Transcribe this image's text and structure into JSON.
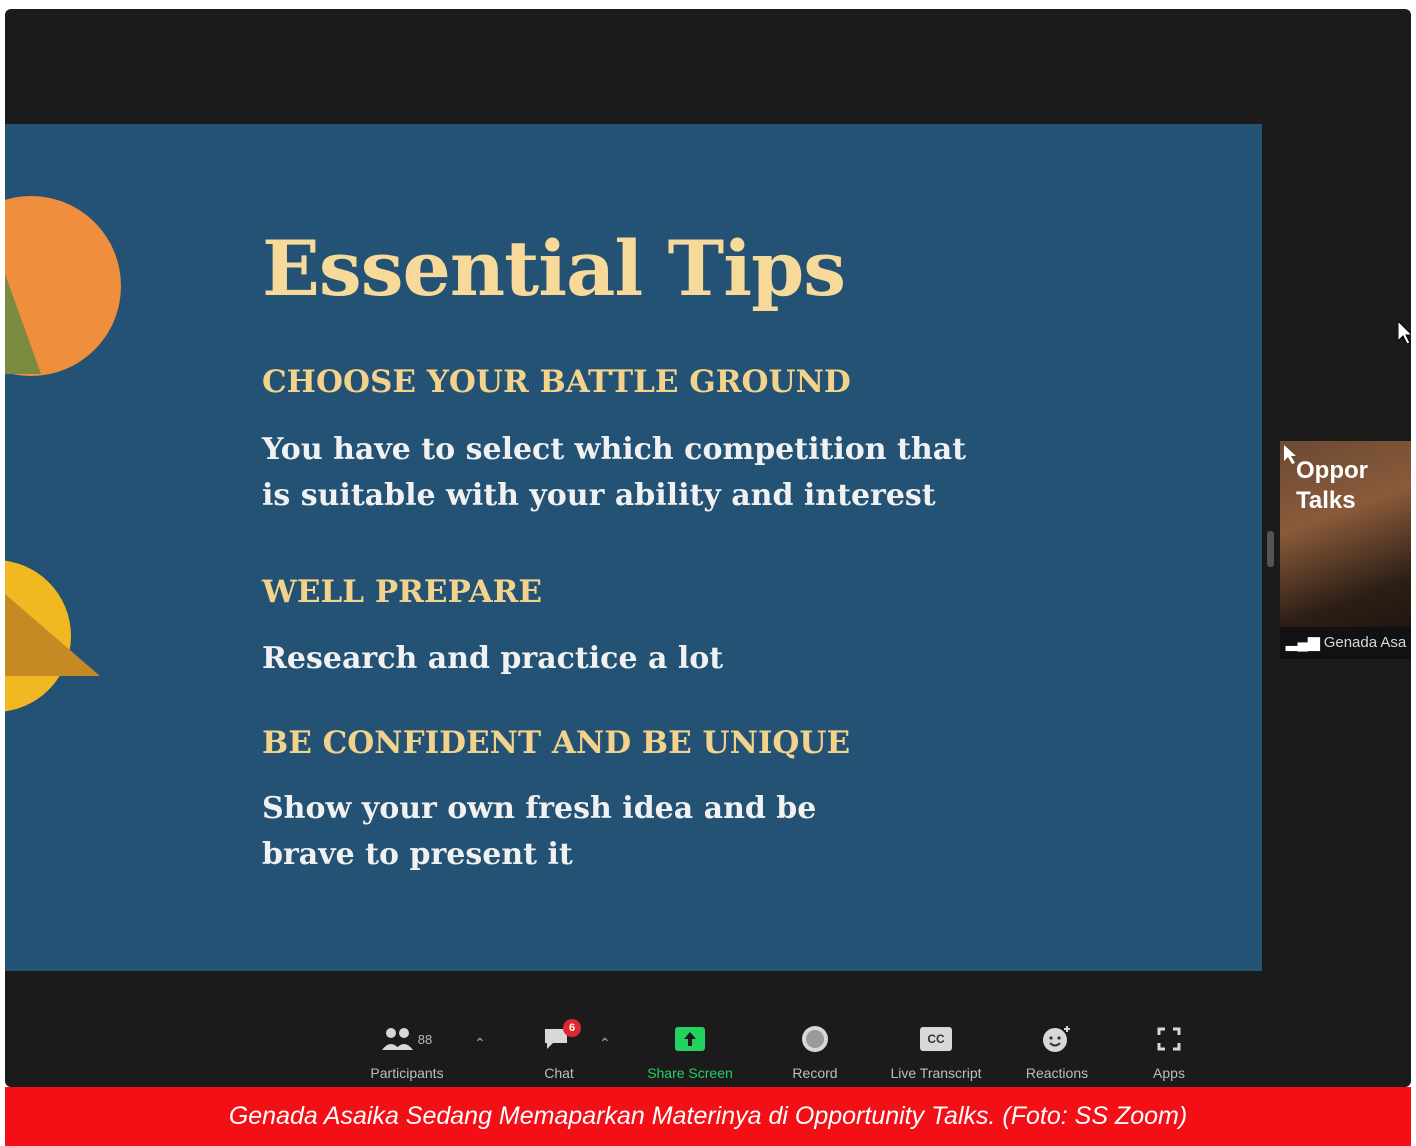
{
  "slide": {
    "title": "Essential Tips",
    "sections": [
      {
        "heading": "CHOOSE YOUR BATTLE GROUND",
        "lines": [
          "You have to select which competition that",
          "is suitable with your ability and interest"
        ]
      },
      {
        "heading": "WELL PREPARE",
        "lines": [
          "Research and practice a lot"
        ]
      },
      {
        "heading": "BE CONFIDENT AND BE UNIQUE",
        "lines": [
          "Show your own fresh idea and be",
          "brave to present it"
        ]
      }
    ]
  },
  "video_thumb": {
    "title_line1": "Oppor",
    "title_line2": "Talks",
    "participant_name": "Genada Asa"
  },
  "toolbar": {
    "participants_label": "Participants",
    "participants_count": "88",
    "chat_label": "Chat",
    "chat_badge": "6",
    "share_label": "Share Screen",
    "record_label": "Record",
    "transcript_label": "Live Transcript",
    "transcript_icon_text": "CC",
    "reactions_label": "Reactions",
    "apps_label": "Apps"
  },
  "caption": "Genada Asaika Sedang Memaparkan Materinya di Opportunity Talks. (Foto: SS Zoom)",
  "colors": {
    "slide_bg": "#235274",
    "title": "#f7d99a",
    "share_green": "#23d160",
    "caption_bg": "#f40e16"
  }
}
